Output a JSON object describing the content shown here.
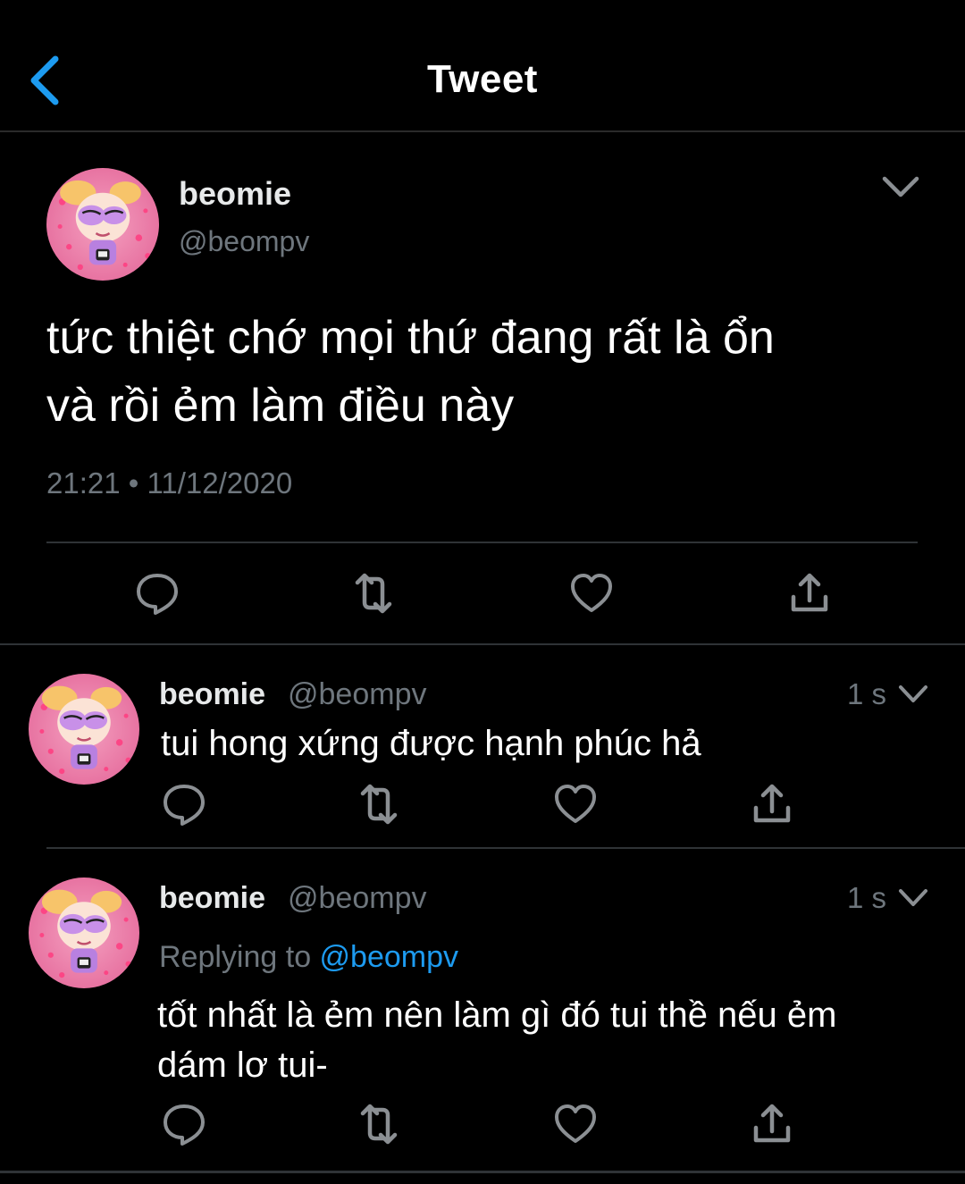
{
  "header": {
    "title": "Tweet",
    "back_icon": "chevron-left-icon",
    "accent": "#1d9bf0"
  },
  "main_tweet": {
    "name": "beomie",
    "handle": "@beompv",
    "text_line1": "tức thiệt chớ mọi thứ đang rất là ổn",
    "text_line2": "và rồi ẻm làm điều này",
    "timestamp": "21:21 • 11/12/2020"
  },
  "replies": [
    {
      "name": "beomie",
      "handle": "@beompv",
      "time": "1 s",
      "text": "tui hong xứng được hạnh phúc hả"
    },
    {
      "name": "beomie",
      "handle": "@beompv",
      "time": "1 s",
      "replying_prefix": "Replying to ",
      "replying_to": "@beompv",
      "text_line1": "tốt nhất là ẻm nên làm gì đó tui thề nếu ẻm",
      "text_line2": "dám lơ tui-"
    }
  ],
  "actions": [
    "reply-icon",
    "retweet-icon",
    "like-icon",
    "share-icon"
  ]
}
